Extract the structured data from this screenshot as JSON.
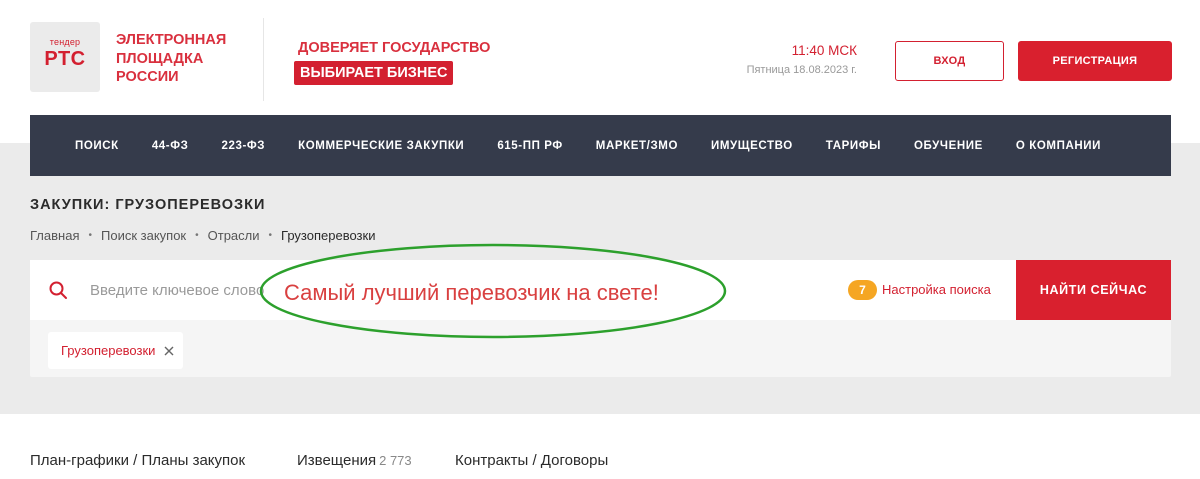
{
  "header": {
    "logo_small": "тендер",
    "logo_big": "РТС",
    "logo_lines": [
      "ЭЛЕКТРОННАЯ",
      "ПЛОЩАДКА",
      "РОССИИ"
    ],
    "slogan_top": "ДОВЕРЯЕТ ГОСУДАРСТВО",
    "slogan_bottom": "ВЫБИРАЕТ БИЗНЕС",
    "time": "11:40 МСК",
    "date": "Пятница 18.08.2023 г.",
    "login_label": "ВХОД",
    "register_label": "РЕГИСТРАЦИЯ"
  },
  "nav": {
    "items": [
      "ПОИСК",
      "44-ФЗ",
      "223-ФЗ",
      "КОММЕРЧЕСКИЕ ЗАКУПКИ",
      "615-ПП РФ",
      "МАРКЕТ/ЗМО",
      "ИМУЩЕСТВО",
      "ТАРИФЫ",
      "ОБУЧЕНИЕ",
      "О КОМПАНИИ"
    ]
  },
  "page": {
    "title": "ЗАКУПКИ: ГРУЗОПЕРЕВОЗКИ",
    "breadcrumb": [
      "Главная",
      "Поиск закупок",
      "Отрасли",
      "Грузоперевозки"
    ]
  },
  "search": {
    "placeholder": "Введите ключевое слово",
    "settings_count": "7",
    "settings_label": "Настройка поиска",
    "button_label": "НАЙТИ СЕЙЧАС",
    "tag_label": "Грузоперевозки"
  },
  "annotation": {
    "text": "Самый лучший перевозчик на свете!",
    "ellipse_color": "#2ca02c",
    "text_color": "#d94040"
  },
  "tabs": [
    {
      "label": "План-графики / Планы закупок",
      "count": ""
    },
    {
      "label": "Извещения",
      "count": "2 773"
    },
    {
      "label": "Контракты / Договоры",
      "count": ""
    }
  ],
  "colors": {
    "brand_red": "#d32030",
    "nav_bg": "#353b4b",
    "badge_orange": "#f5a623"
  }
}
